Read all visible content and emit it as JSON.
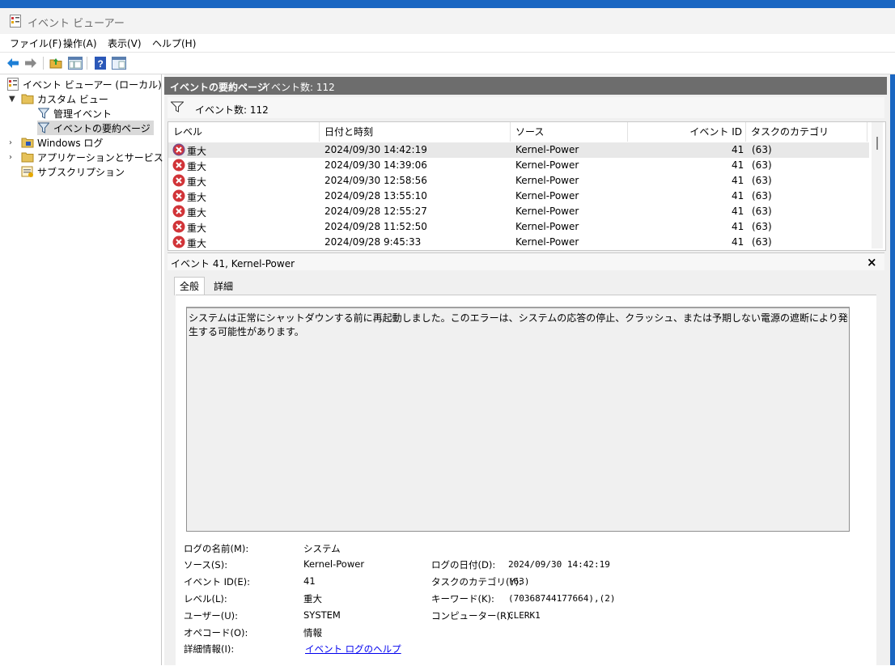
{
  "window": {
    "title": "イベント ビューアー"
  },
  "menu": [
    "ファイル(F)",
    "操作(A)",
    "表示(V)",
    "ヘルプ(H)"
  ],
  "toolbar": {
    "icons": [
      "back-arrow-icon",
      "forward-arrow-icon",
      "folder-up-icon",
      "console-view-icon",
      "help-icon",
      "properties-icon"
    ]
  },
  "tree": {
    "root": "イベント ビューアー (ローカル)",
    "custom_views": "カスタム ビュー",
    "admin_events": "管理イベント",
    "summary_page": "イベントの要約ページ",
    "windows_logs": "Windows ログ",
    "app_service_logs": "アプリケーションとサービス ログ",
    "subscriptions": "サブスクリプション"
  },
  "header": {
    "title": "イベントの要約ページ",
    "count": "イベント数: 112"
  },
  "filter": {
    "label": "イベント数: 112"
  },
  "columns": {
    "level": "レベル",
    "datetime": "日付と時刻",
    "source": "ソース",
    "event_id": "イベント ID",
    "task": "タスクのカテゴリ"
  },
  "events": [
    {
      "level": "重大",
      "datetime": "2024/09/30 14:42:19",
      "source": "Kernel-Power",
      "id": "41",
      "task": "(63)"
    },
    {
      "level": "重大",
      "datetime": "2024/09/30 14:39:06",
      "source": "Kernel-Power",
      "id": "41",
      "task": "(63)"
    },
    {
      "level": "重大",
      "datetime": "2024/09/30 12:58:56",
      "source": "Kernel-Power",
      "id": "41",
      "task": "(63)"
    },
    {
      "level": "重大",
      "datetime": "2024/09/28 13:55:10",
      "source": "Kernel-Power",
      "id": "41",
      "task": "(63)"
    },
    {
      "level": "重大",
      "datetime": "2024/09/28 12:55:27",
      "source": "Kernel-Power",
      "id": "41",
      "task": "(63)"
    },
    {
      "level": "重大",
      "datetime": "2024/09/28 11:52:50",
      "source": "Kernel-Power",
      "id": "41",
      "task": "(63)"
    },
    {
      "level": "重大",
      "datetime": "2024/09/28 9:45:33",
      "source": "Kernel-Power",
      "id": "41",
      "task": "(63)"
    }
  ],
  "detail": {
    "title": "イベント 41, Kernel-Power",
    "close": "×",
    "tabs": [
      "全般",
      "詳細"
    ],
    "message": "システムは正常にシャットダウンする前に再起動しました。このエラーは、システムの応答の停止、クラッシュ、または予期しない電源の遮断により発生する可能性があります。",
    "fields": {
      "log_name_label": "ログの名前(M):",
      "log_name": "システム",
      "source_label": "ソース(S):",
      "source": "Kernel-Power",
      "logged_label": "ログの日付(D):",
      "logged": "2024/09/30 14:42:19",
      "event_id_label": "イベント ID(E):",
      "event_id": "41",
      "task_label": "タスクのカテゴリ(Y):",
      "task": "(63)",
      "level_label": "レベル(L):",
      "level": "重大",
      "keywords_label": "キーワード(K):",
      "keywords": "(70368744177664),(2)",
      "user_label": "ユーザー(U):",
      "user": "SYSTEM",
      "computer_label": "コンピューター(R):",
      "computer": "CLERK1",
      "opcode_label": "オペコード(O):",
      "opcode": "情報",
      "more_info_label": "詳細情報(I):",
      "more_info": "イベント ログのヘルプ"
    }
  },
  "colors": {
    "accent": "#1a66c2",
    "header_bg": "#6d6d6d",
    "error_red": "#d13438",
    "link": "#0000ee"
  }
}
